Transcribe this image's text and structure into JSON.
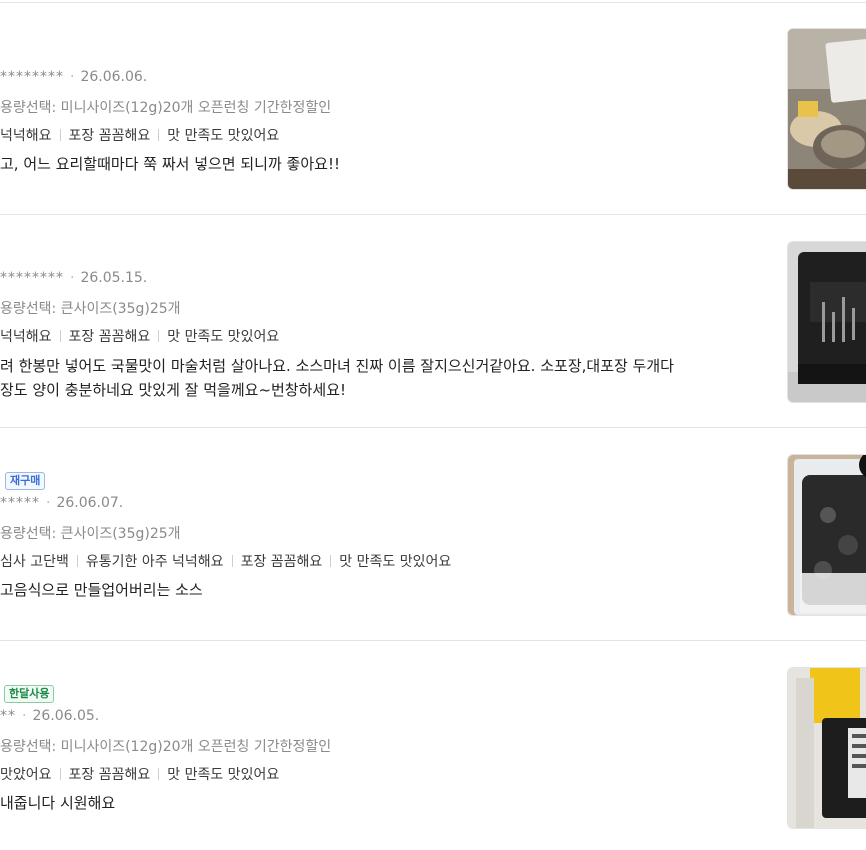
{
  "reviews": [
    {
      "user": "********",
      "date": "26.06.06.",
      "badge": "",
      "option": "용량선택: 미니사이즈(12g)20개 오픈런칭 기간한정할인",
      "tags": [
        "넉넉해요",
        "포장 꼼꼼해요",
        "맛 만족도 맛있어요"
      ],
      "body": [
        "고, 어느 요리할때마다 쭉 짜서 넣으면 되니까 좋아요!!"
      ],
      "image": "review-photo-1"
    },
    {
      "user": "********",
      "date": "26.05.15.",
      "badge": "",
      "option": "용량선택: 큰사이즈(35g)25개",
      "tags": [
        "넉넉해요",
        "포장 꼼꼼해요",
        "맛 만족도 맛있어요"
      ],
      "body": [
        "려 한봉만 넣어도 국물맛이 마술처럼 살아나요. 소스마녀 진짜 이름 잘지으신거같아요. 소포장,대포장 두개다",
        "장도 양이 충분하네요 맛있게 잘 먹을께요~번창하세요!"
      ],
      "image": "review-photo-2"
    },
    {
      "user": "*****",
      "date": "26.06.07.",
      "badge": "재구매",
      "option": "용량선택: 큰사이즈(35g)25개",
      "tags": [
        "심사 고단백",
        "유통기한 아주 넉넉해요",
        "포장 꼼꼼해요",
        "맛 만족도 맛있어요"
      ],
      "body": [
        "고음식으로 만들업어버리는 소스"
      ],
      "image": "review-photo-3"
    },
    {
      "user": "**",
      "date": "26.06.05.",
      "badge": "한달사용",
      "option": "용량선택: 미니사이즈(12g)20개 오픈런칭 기간한정할인",
      "tags": [
        "맛았어요",
        "포장 꼼꼼해요",
        "맛 만족도 맛있어요"
      ],
      "body": [
        "내줍니다 시원해요"
      ],
      "image": "review-photo-4"
    }
  ],
  "colors": {
    "divider": "#e4e4e4",
    "meta": "#8a8a8a",
    "rebuy_badge": "#3a6fd8",
    "month_badge": "#1e8a4a"
  }
}
